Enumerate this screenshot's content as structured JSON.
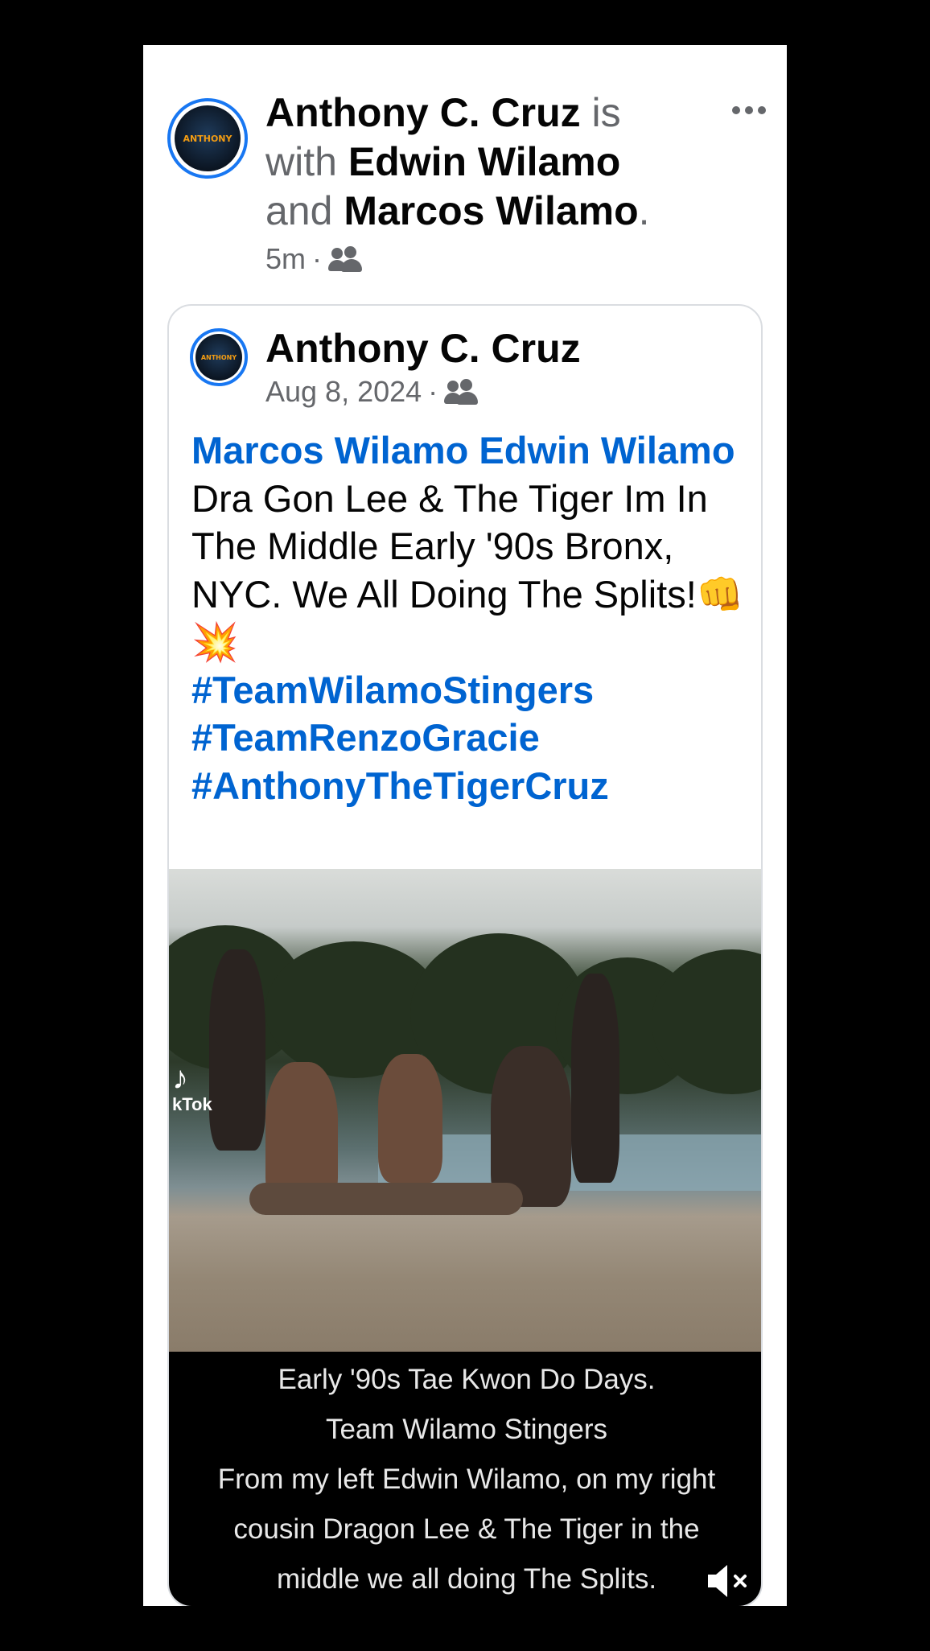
{
  "header": {
    "author": "Anthony C. Cruz",
    "is_text": "is",
    "with_text": "with",
    "tag1": "Edwin Wilamo",
    "and_text": "and",
    "tag2": "Marcos Wilamo",
    "period": ".",
    "time": "5m",
    "dot": "·",
    "audience_icon": "friends-icon",
    "more_icon": "more-options-icon",
    "avatar_text": "ANTHONY"
  },
  "shared": {
    "author": "Anthony C. Cruz",
    "date": "Aug 8, 2024",
    "dot": "·",
    "audience_icon": "friends-icon",
    "avatar_text": "ANTHONY",
    "mention1": "Marcos Wilamo",
    "mention2": "Edwin Wilamo",
    "mention3": "Wilamo",
    "text": "Dra Gon Lee & The Tiger Im In The Middle Early '90s Bronx, NYC. We All Doing The Splits!👊💥",
    "hashtags": [
      "#TeamWilamoStingers",
      "#TeamRenzoGracie",
      "#AnthonyTheTigerCruz"
    ]
  },
  "video": {
    "watermark": "kTok",
    "caption_lines": [
      "Early '90s Tae Kwon Do Days.",
      "Team Wilamo Stingers",
      "From my left Edwin Wilamo, on my right",
      "cousin Dragon Lee & The Tiger in the",
      "middle we all doing The Splits.",
      "👊💥"
    ],
    "mute_icon": "muted-speaker-icon"
  },
  "colors": {
    "link": "#0064d1",
    "avatar_ring": "#1877f2",
    "meta_gray": "#65676b"
  }
}
